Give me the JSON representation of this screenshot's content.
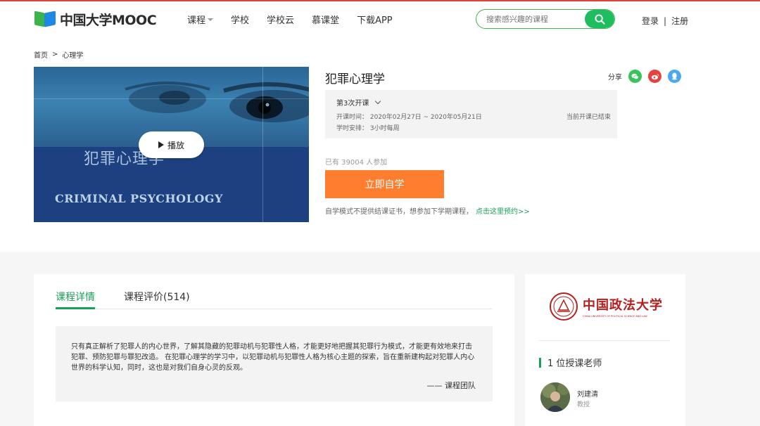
{
  "header": {
    "logo_text": "中国大学MOOC",
    "nav": [
      "课程",
      "学校",
      "学校云",
      "慕课堂",
      "下载APP"
    ],
    "search_placeholder": "搜索感兴趣的课程",
    "login": "登录",
    "separator": "|",
    "register": "注册"
  },
  "breadcrumb": {
    "home": "首页",
    "gt": ">",
    "current": "心理学"
  },
  "course": {
    "cover_cn": "犯罪心理学",
    "cover_en": "CRIMINAL PSYCHOLOGY",
    "play_label": "播放",
    "title": "犯罪心理学",
    "share_label": "分享",
    "term": "第3次开课",
    "time_line": "开课时间： 2020年02月27日 ~ 2020年05月21日",
    "schedule_line": "学时安排： 3小时每周",
    "status": "当前开课已结束",
    "joined": "已有 39004 人参加",
    "cta": "立即自学",
    "note": "自学模式不提供结课证书，想参加下学期课程，",
    "note_link": "点击这里预约>>"
  },
  "details": {
    "tab_detail": "课程详情",
    "tab_review": "课程评价(514)",
    "description": "只有真正解析了犯罪人的内心世界，了解其隐藏的犯罪动机与犯罪性人格，才能更好地把握其犯罪行为模式，才能更有效地来打击犯罪、预防犯罪与罪犯改造。 在犯罪心理学的学习中，以犯罪动机与犯罪性人格为核心主题的探索，旨在重新建构起对犯罪人内心世界的科学认知，同时，这也是对我们自身心灵的反观。",
    "signature": "—— 课程团队"
  },
  "sidebar": {
    "university_name": "中国政法大学",
    "university_en": "CHINA UNIVERSITY OF POLITICAL SCIENCE AND LAW",
    "teacher_heading": "1 位授课老师",
    "teacher_name": "刘建清",
    "teacher_role": "教授"
  },
  "colors": {
    "brand_green": "#18a058",
    "cta_orange": "#ff7d2e",
    "accent_red": "#e0413b"
  }
}
